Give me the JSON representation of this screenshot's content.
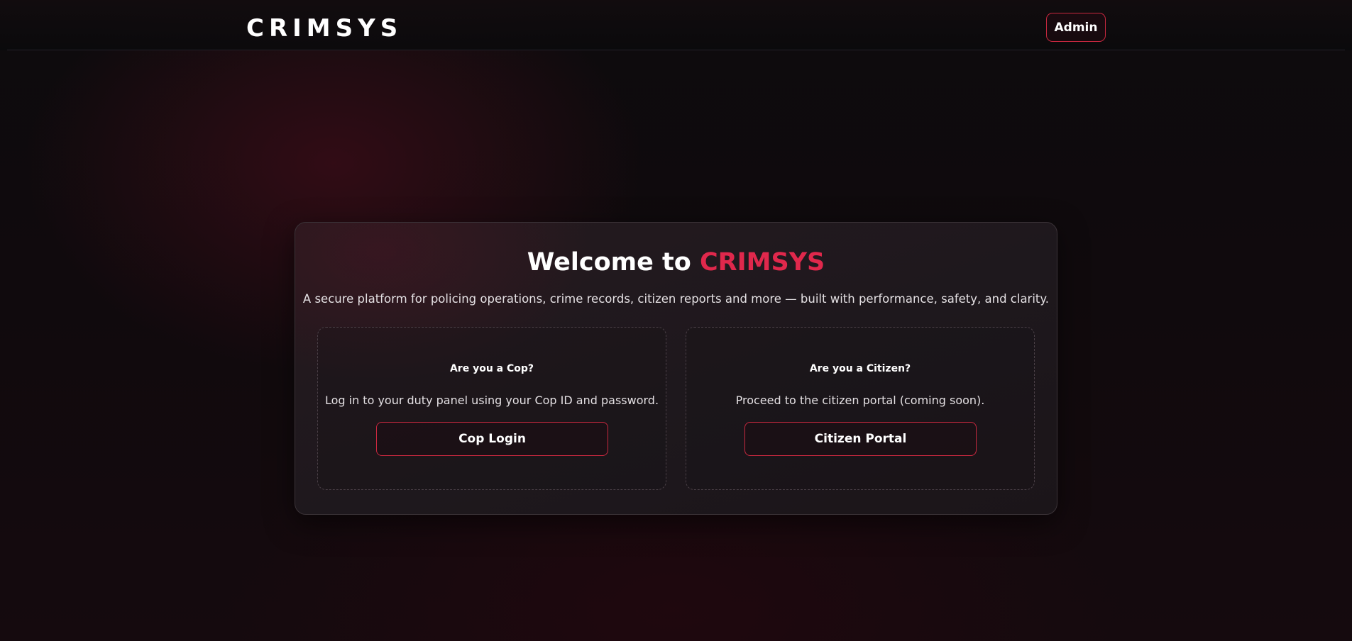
{
  "header": {
    "brand": "CRIMSYS",
    "admin_label": "Admin"
  },
  "hero": {
    "welcome_prefix": "Welcome to",
    "welcome_brand": "CRIMSYS",
    "subtitle": "A secure platform for policing operations, crime records, citizen reports and more — built with performance, safety, and clarity."
  },
  "panels": [
    {
      "title": "Are you a Cop?",
      "description": "Log in to your duty panel using your Cop ID and password.",
      "button_label": "Cop Login"
    },
    {
      "title": "Are you a Citizen?",
      "description": "Proceed to the citizen portal (coming soon).",
      "button_label": "Citizen Portal"
    }
  ],
  "colors": {
    "accent": "#e0284c",
    "button_border": "#c8283f",
    "background": "#100a0d",
    "card": "#1f181c"
  }
}
